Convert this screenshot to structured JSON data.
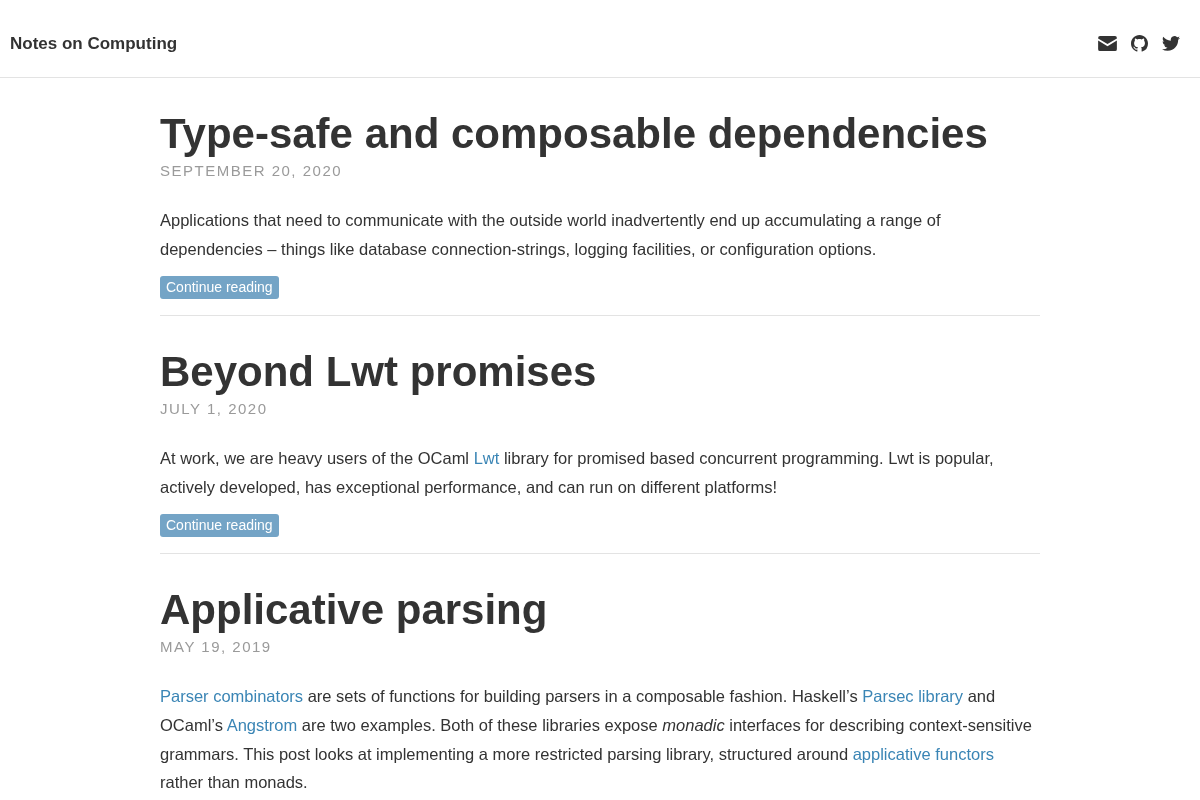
{
  "site": {
    "title": "Notes on Computing"
  },
  "posts": [
    {
      "title": "Type-safe and composable dependencies",
      "date": "SEPTEMBER 20, 2020",
      "summary": [
        {
          "kind": "text",
          "text": "Applications that need to communicate with the outside world inadvertently end up accumulating a range of dependencies – things like database connection-strings, logging facilities, or configuration options."
        }
      ],
      "button": "Continue reading"
    },
    {
      "title": "Beyond Lwt promises",
      "date": "JULY 1, 2020",
      "summary": [
        {
          "kind": "text",
          "text": "At work, we are heavy users of the OCaml "
        },
        {
          "kind": "link",
          "text": "Lwt"
        },
        {
          "kind": "text",
          "text": " library for promised based concurrent programming. Lwt is popular, actively developed, has exceptional performance, and can run on different platforms!"
        }
      ],
      "button": "Continue reading"
    },
    {
      "title": "Applicative parsing",
      "date": "MAY 19, 2019",
      "summary": [
        {
          "kind": "link",
          "text": "Parser combinators"
        },
        {
          "kind": "text",
          "text": " are sets of functions for building parsers in a composable fashion. Haskell’s "
        },
        {
          "kind": "link",
          "text": "Parsec library"
        },
        {
          "kind": "text",
          "text": " and OCaml’s "
        },
        {
          "kind": "link",
          "text": "Angstrom"
        },
        {
          "kind": "text",
          "text": " are two examples. Both of these libraries expose *monadic* interfaces for describing context-sensitive grammars. This post looks at implementing a more restricted parsing library, structured around "
        },
        {
          "kind": "link",
          "text": "applicative functors"
        },
        {
          "kind": "text",
          "text": " rather than monads."
        }
      ]
    }
  ]
}
